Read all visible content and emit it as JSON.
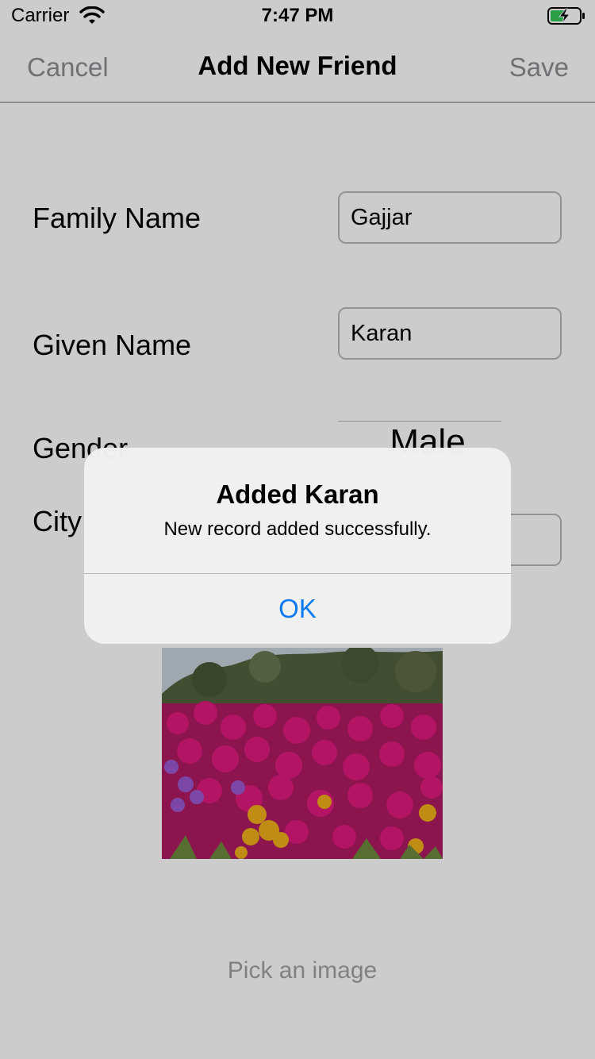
{
  "status_bar": {
    "carrier": "Carrier",
    "time": "7:47 PM",
    "icons": [
      "wifi-icon",
      "battery-charging-icon"
    ]
  },
  "nav": {
    "cancel_label": "Cancel",
    "title": "Add New Friend",
    "save_label": "Save"
  },
  "form": {
    "family_name": {
      "label": "Family Name",
      "value": "Gajjar"
    },
    "given_name": {
      "label": "Given Name",
      "value": "Karan"
    },
    "gender": {
      "label": "Gender",
      "selected": "Male"
    },
    "city": {
      "label": "City",
      "value": ""
    }
  },
  "photo": {
    "subject": "pink and magenta ice plant flowers with yellow blooms, green shrubs behind"
  },
  "pick_image_label": "Pick an image",
  "alert": {
    "title": "Added Karan",
    "message": "New record added successfully.",
    "ok_label": "OK"
  },
  "colors": {
    "accent_blue": "#0A7AF2",
    "muted_gray": "#8E8E93",
    "field_border": "#B8B8B8"
  }
}
